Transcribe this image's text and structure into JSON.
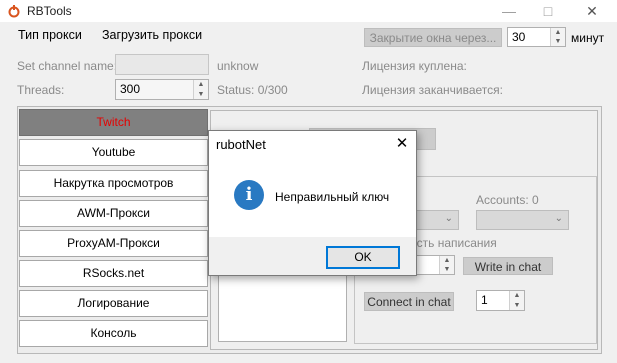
{
  "window": {
    "title": "RBTools"
  },
  "menu": {
    "items": [
      "Тип прокси",
      "Загрузить прокси"
    ]
  },
  "toolbar": {
    "close_window_button": "Закрытие окна через...",
    "close_minutes_value": "30",
    "minutes_label": "минут"
  },
  "settings": {
    "set_channel_label": "Set channel name:",
    "channel_placeholder": "",
    "unknow_text": "unknow",
    "threads_label": "Threads:",
    "threads_value": "300",
    "status_text": "Status: 0/300",
    "license_bought": "Лицензия куплена:",
    "license_expires": "Лицензия заканчивается:"
  },
  "nav": {
    "items": [
      "Twitch",
      "Youtube",
      "Накрутка просмотров",
      "AWM-Прокси",
      "ProxyAM-Прокси",
      "RSocks.net",
      "Логирование",
      "Консоль"
    ],
    "active": "Twitch"
  },
  "twitch_panel": {
    "accounts_label": "Accounts: 0",
    "speed_label_partial": "ость написания",
    "write_in_chat_button": "Write in chat",
    "connect_in_chat_button": "Connect in chat",
    "connect_value": "1"
  },
  "dialog": {
    "title": "rubotNet",
    "message": "Неправильный ключ",
    "ok_button": "OK",
    "icon": "info-icon"
  },
  "colors": {
    "active_tab_text": "#e60000",
    "active_tab_bg": "#808080",
    "dialog_accent": "#0078d7",
    "info_icon": "#2979c2"
  }
}
